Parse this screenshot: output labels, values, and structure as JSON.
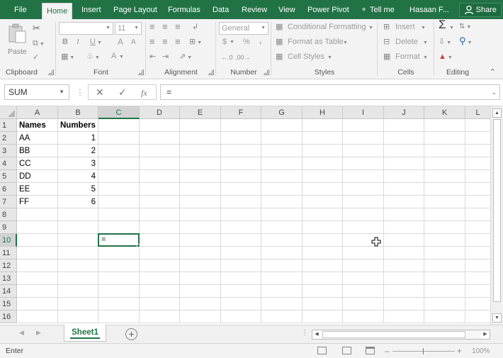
{
  "ribbon_tabs": [
    "File",
    "Home",
    "Insert",
    "Page Layout",
    "Formulas",
    "Data",
    "Review",
    "View",
    "Power Pivot",
    "Tell me",
    "Hasaan F..."
  ],
  "active_tab": "Home",
  "share_label": "Share",
  "clipboard": {
    "paste": "Paste",
    "label": "Clipboard"
  },
  "font": {
    "name": "",
    "size": "11",
    "label": "Font",
    "bold": "B",
    "italic": "I",
    "underline": "U",
    "grow": "A",
    "shrink": "A",
    "color_a": "A"
  },
  "alignment": {
    "label": "Alignment"
  },
  "number": {
    "format": "General",
    "currency": "$",
    "percent": "%",
    "comma": ",",
    "inc_dec": "⁰.00",
    "label": "Number"
  },
  "styles": {
    "conditional": "Conditional Formatting",
    "format_table": "Format as Table",
    "cell_styles": "Cell Styles",
    "label": "Styles"
  },
  "cells": {
    "insert": "Insert",
    "delete": "Delete",
    "format": "Format",
    "label": "Cells"
  },
  "editing": {
    "label": "Editing"
  },
  "formula_bar": {
    "name_box": "SUM",
    "formula": "=",
    "fx": "fx"
  },
  "columns": [
    "A",
    "B",
    "C",
    "D",
    "E",
    "F",
    "G",
    "H",
    "I",
    "J",
    "K",
    "L"
  ],
  "selected_column": "C",
  "rows": [
    "1",
    "2",
    "3",
    "4",
    "5",
    "6",
    "7",
    "8",
    "9",
    "10",
    "11",
    "12",
    "13",
    "14",
    "15",
    "16"
  ],
  "selected_row": "10",
  "headers": {
    "names": "Names",
    "numbers": "Numbers"
  },
  "table": [
    {
      "name": "AA",
      "number": "1"
    },
    {
      "name": "BB",
      "number": "2"
    },
    {
      "name": "CC",
      "number": "3"
    },
    {
      "name": "DD",
      "number": "4"
    },
    {
      "name": "EE",
      "number": "5"
    },
    {
      "name": "FF",
      "number": "6"
    }
  ],
  "active_cell": {
    "ref": "C10",
    "value": "="
  },
  "sheet_tab": "Sheet1",
  "status": "Enter",
  "zoom": "100%",
  "colors": {
    "accent": "#217346"
  }
}
